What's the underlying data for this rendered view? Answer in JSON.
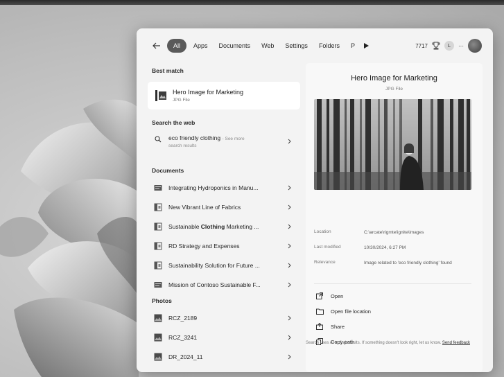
{
  "header": {
    "filters": [
      "All",
      "Apps",
      "Documents",
      "Web",
      "Settings",
      "Folders",
      "P"
    ],
    "status_text": "7717",
    "user_initial": "L",
    "more": "···"
  },
  "best_match": {
    "section": "Best match",
    "title": "Hero Image for Marketing",
    "subtitle": "JPG File"
  },
  "web": {
    "section": "Search the web",
    "query": "eco friendly clothing",
    "see_more": "- See more",
    "results": "search results"
  },
  "documents": {
    "section": "Documents",
    "items": [
      {
        "label": "Integrating Hydroponics in Manu...",
        "icon": "document-icon"
      },
      {
        "label": "New Vibrant Line of Fabrics",
        "icon": "presentation-icon"
      },
      {
        "label_pre": "Sustainable ",
        "label_bold": "Clothing",
        "label_post": " Marketing ...",
        "icon": "presentation-icon"
      },
      {
        "label": "RD Strategy and Expenses",
        "icon": "presentation-icon"
      },
      {
        "label": "Sustainability Solution for Future ...",
        "icon": "presentation-icon"
      },
      {
        "label": "Mission of Contoso Sustainable F...",
        "icon": "document-icon"
      }
    ]
  },
  "photos": {
    "section": "Photos",
    "items": [
      {
        "label": "RCZ_2189",
        "icon": "photo-icon"
      },
      {
        "label": "RCZ_3241",
        "icon": "photo-icon"
      },
      {
        "label": "DR_2024_11",
        "icon": "photo-icon"
      }
    ]
  },
  "preview": {
    "title": "Hero Image for Marketing",
    "subtitle": "JPG File",
    "meta": [
      {
        "key": "Location",
        "value": "C:\\arcate\\rigmte\\ignite\\images"
      },
      {
        "key": "Last modified",
        "value": "10/30/2024, 6:27 PM"
      },
      {
        "key": "Relevance",
        "value": "Image related to 'eco friendly clothing' found"
      }
    ],
    "actions": [
      {
        "label": "Open",
        "icon": "open-icon"
      },
      {
        "label": "Open file location",
        "icon": "folder-icon"
      },
      {
        "label": "Share",
        "icon": "share-icon"
      },
      {
        "label": "Copy path",
        "icon": "copy-icon"
      }
    ],
    "feedback": "Search uses AI to find results. If something doesn't look right, let us know.",
    "feedback_link": "Send feedback"
  }
}
